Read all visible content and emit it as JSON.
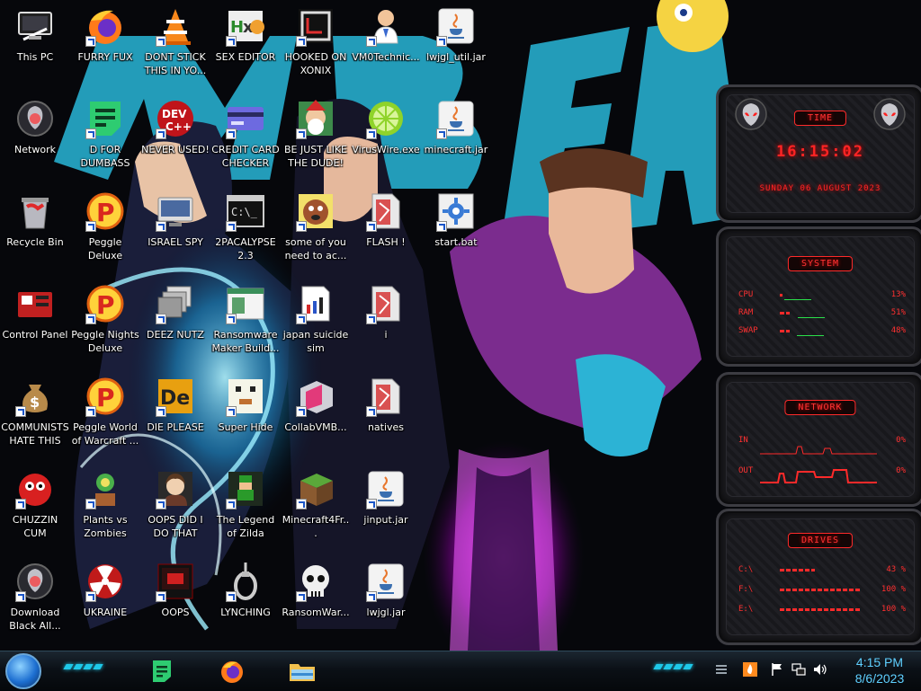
{
  "desktop": {
    "icons": [
      {
        "id": "this-pc",
        "label": "This PC",
        "icon": "computer-icon",
        "col": 0,
        "row": 0
      },
      {
        "id": "furry-fux",
        "label": "FURRY FUX",
        "icon": "firefox-icon",
        "col": 1,
        "row": 0
      },
      {
        "id": "dont-stick",
        "label": "DONT STICK THIS IN YO...",
        "icon": "vlc-cone-icon",
        "col": 2,
        "row": 0
      },
      {
        "id": "sex-editor",
        "label": "SEX EDITOR",
        "icon": "hex-editor-icon",
        "col": 3,
        "row": 0
      },
      {
        "id": "hooked-on-xonix",
        "label": "HOOKED ON XONIX",
        "icon": "xonix-game-icon",
        "col": 4,
        "row": 0
      },
      {
        "id": "vm0technic",
        "label": "VM0Technic...",
        "icon": "doctor-icon",
        "col": 5,
        "row": 0
      },
      {
        "id": "lwjgl-util",
        "label": "lwjgl_util.jar",
        "icon": "java-jar-icon",
        "col": 6,
        "row": 0
      },
      {
        "id": "network",
        "label": "Network",
        "icon": "alienware-orb-icon",
        "col": 0,
        "row": 1
      },
      {
        "id": "d-for-dumbass",
        "label": "D FOR DUMBASS",
        "icon": "green-doc-icon",
        "col": 1,
        "row": 1
      },
      {
        "id": "never-used",
        "label": "NEVER USED!",
        "icon": "devcpp-icon",
        "col": 2,
        "row": 1
      },
      {
        "id": "credit-card-checker",
        "label": "CREDIT CARD CHECKER",
        "icon": "credit-card-icon",
        "col": 3,
        "row": 1
      },
      {
        "id": "be-just-like-the-dude",
        "label": "BE JUST LIKE THE DUDE!",
        "icon": "elf-portrait-icon",
        "col": 4,
        "row": 1
      },
      {
        "id": "viruswire",
        "label": "VirusWire.exe",
        "icon": "lime-icon",
        "col": 5,
        "row": 1
      },
      {
        "id": "minecraft-jar",
        "label": "minecraft.jar",
        "icon": "java-jar-icon",
        "col": 6,
        "row": 1
      },
      {
        "id": "recycle-bin",
        "label": "Recycle Bin",
        "icon": "recycle-bin-icon",
        "col": 0,
        "row": 2
      },
      {
        "id": "peggle-deluxe",
        "label": "Peggle Deluxe",
        "icon": "peggle-icon",
        "col": 1,
        "row": 2
      },
      {
        "id": "israel-spy",
        "label": "ISRAEL SPY",
        "icon": "monitor-app-icon",
        "col": 2,
        "row": 2
      },
      {
        "id": "2pacalypse",
        "label": "2PACALYPSE 2.3",
        "icon": "terminal-icon",
        "col": 3,
        "row": 2
      },
      {
        "id": "some-of-you",
        "label": "some of you need to ac...",
        "icon": "cartoon-dog-icon",
        "col": 4,
        "row": 2
      },
      {
        "id": "flash",
        "label": "FLASH !",
        "icon": "flash-doc-icon",
        "col": 5,
        "row": 2
      },
      {
        "id": "start-bat",
        "label": "start.bat",
        "icon": "gear-script-icon",
        "col": 6,
        "row": 2
      },
      {
        "id": "control-panel",
        "label": "Control Panel",
        "icon": "control-panel-icon",
        "col": 0,
        "row": 3
      },
      {
        "id": "peggle-nights",
        "label": "Peggle Nights Deluxe",
        "icon": "peggle-icon",
        "col": 1,
        "row": 3
      },
      {
        "id": "deez-nutz",
        "label": "DEEZ NUTZ",
        "icon": "stacked-windows-icon",
        "col": 2,
        "row": 3
      },
      {
        "id": "ransomware-maker",
        "label": "Ransomware Maker Build...",
        "icon": "app-window-icon",
        "col": 3,
        "row": 3
      },
      {
        "id": "japan-suicide-sim",
        "label": "japan suicide sim",
        "icon": "bars-doc-icon",
        "col": 4,
        "row": 3
      },
      {
        "id": "i-file",
        "label": "i",
        "icon": "flash-doc-icon",
        "col": 5,
        "row": 3
      },
      {
        "id": "communists",
        "label": "COMMUNISTS HATE THIS G...",
        "icon": "money-bag-icon",
        "col": 0,
        "row": 4
      },
      {
        "id": "peggle-world",
        "label": "Peggle World of Warcraft ...",
        "icon": "peggle-icon",
        "col": 1,
        "row": 4
      },
      {
        "id": "die-please",
        "label": "DIE PLEASE",
        "icon": "die-icon",
        "col": 2,
        "row": 4
      },
      {
        "id": "super-hide",
        "label": "Super Hide",
        "icon": "pixel-creature-icon",
        "col": 3,
        "row": 4
      },
      {
        "id": "collabvm",
        "label": "CollabVMB...",
        "icon": "cube-app-icon",
        "col": 4,
        "row": 4
      },
      {
        "id": "natives",
        "label": "natives",
        "icon": "flash-doc-icon",
        "col": 5,
        "row": 4
      },
      {
        "id": "chuzzin-cum",
        "label": "CHUZZIN CUM",
        "icon": "chuzzle-icon",
        "col": 0,
        "row": 5
      },
      {
        "id": "plants-vs-zombies",
        "label": "Plants vs Zombies",
        "icon": "plant-icon",
        "col": 1,
        "row": 5
      },
      {
        "id": "oops-did-i",
        "label": "OOPS DID I DO THAT",
        "icon": "portrait-icon",
        "col": 2,
        "row": 5
      },
      {
        "id": "legend-of-zilda",
        "label": "The Legend of Zilda",
        "icon": "pixel-hero-icon",
        "col": 3,
        "row": 5
      },
      {
        "id": "minecraft4fr",
        "label": "Minecraft4Fr...",
        "icon": "grass-block-icon",
        "col": 4,
        "row": 5
      },
      {
        "id": "jinput-jar",
        "label": "jinput.jar",
        "icon": "java-jar-icon",
        "col": 5,
        "row": 5
      },
      {
        "id": "download-black",
        "label": "Download Black All...",
        "icon": "alienware-orb-icon",
        "col": 0,
        "row": 6
      },
      {
        "id": "ukraine",
        "label": "UKRAINE",
        "icon": "radiation-icon",
        "col": 1,
        "row": 6
      },
      {
        "id": "oops",
        "label": "OOPS",
        "icon": "red-window-icon",
        "col": 2,
        "row": 6
      },
      {
        "id": "lynching",
        "label": "LYNCHING",
        "icon": "noose-icon",
        "col": 3,
        "row": 6
      },
      {
        "id": "ransomwar",
        "label": "RansomWar...",
        "icon": "skull-icon",
        "col": 4,
        "row": 6
      },
      {
        "id": "lwjgl-jar",
        "label": "lwjgl.jar",
        "icon": "java-jar-icon",
        "col": 5,
        "row": 6
      }
    ]
  },
  "widgets": {
    "time": {
      "title": "TIME",
      "clock": "16:15:02",
      "date": "SUNDAY 06 AUGUST 2023",
      "icon": "alien-head-icon"
    },
    "system": {
      "title": "SYSTEM",
      "rows": [
        {
          "label": "CPU",
          "value": "13%",
          "fraction": 0.13
        },
        {
          "label": "RAM",
          "value": "51%",
          "fraction": 0.51
        },
        {
          "label": "SWAP",
          "value": "48%",
          "fraction": 0.48
        }
      ]
    },
    "network": {
      "title": "NETWORK",
      "rows": [
        {
          "label": "IN",
          "value": "0%"
        },
        {
          "label": "OUT",
          "value": "0%"
        }
      ]
    },
    "drives": {
      "title": "DRIVES",
      "rows": [
        {
          "label": "C:\\",
          "value": "43 %",
          "fraction": 0.43
        },
        {
          "label": "F:\\",
          "value": "100 %",
          "fraction": 1.0
        },
        {
          "label": "E:\\",
          "value": "100 %",
          "fraction": 1.0
        }
      ]
    }
  },
  "taskbar": {
    "start": "start-orb-icon",
    "pinned": [
      {
        "id": "notes",
        "icon": "green-doc-icon"
      },
      {
        "id": "firefox",
        "icon": "firefox-icon"
      },
      {
        "id": "explorer",
        "icon": "folder-icon"
      }
    ],
    "tray": [
      "flame-icon",
      "flag-icon",
      "network-icon",
      "volume-icon"
    ],
    "clock": {
      "time": "4:15 PM",
      "date": "8/6/2023"
    }
  },
  "colors": {
    "widget_accent": "#ff2a2a",
    "taskbar_accent": "#1ec8e8",
    "clock_text": "#5fd0ff"
  }
}
